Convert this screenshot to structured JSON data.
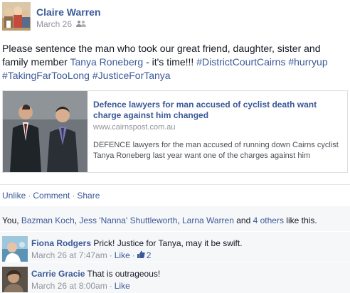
{
  "post": {
    "author": "Claire Warren",
    "date": "March 26",
    "audience_icon": "friends-icon",
    "text_before": "Please sentence the man who took our great friend, daughter, sister and family member ",
    "tagged_person": "Tanya Roneberg",
    "text_after": " - it's time!!! ",
    "hashtags": [
      "#DistrictCourtCairns",
      "#hurryup",
      "#TakingFarTooLong",
      "#JusticeForTanya"
    ]
  },
  "shared_link": {
    "title": "Defence lawyers for man accused of cyclist death want charge against him changed",
    "domain": "www.cairnspost.com.au",
    "description": "DEFENCE lawyers for the man accused of running down Cairns cyclist Tanya Roneberg last year want one of the charges against him"
  },
  "actions": {
    "unlike": "Unlike",
    "comment": "Comment",
    "share": "Share",
    "separator": "·"
  },
  "likes": {
    "you": "You, ",
    "person1": "Bazman Koch",
    "comma1": ", ",
    "person2": "Jess 'Nanna' Shuttleworth",
    "comma2": ", ",
    "person3": "Larna Warren",
    "and": " and ",
    "others": "4 others",
    "suffix": " like this."
  },
  "comments": [
    {
      "name": "Fiona Rodgers",
      "text": "Prick! Justice for Tanya, may it be swift.",
      "time": "March 26 at 7:47am",
      "like_label": "Like",
      "like_count": "2"
    },
    {
      "name": "Carrie Gracie",
      "text": "That is outrageous!",
      "time": "March 26 at 8:00am",
      "like_label": "Like"
    }
  ],
  "colors": {
    "link": "#3b5998",
    "meta": "#90949c",
    "panel": "#f6f7f9"
  }
}
